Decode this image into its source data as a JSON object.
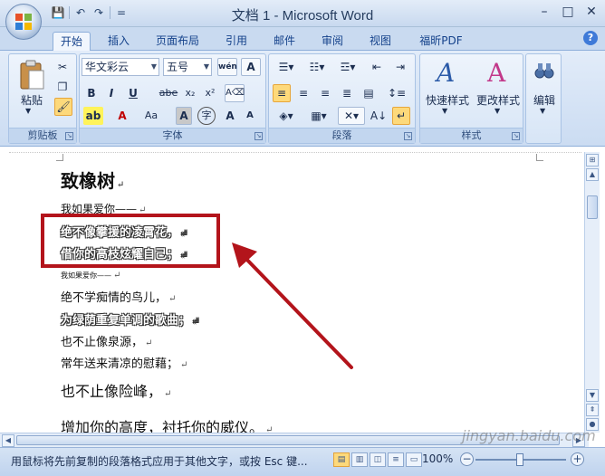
{
  "window": {
    "title": "文档 1 - Microsoft Word",
    "controls": {
      "minimize": "–",
      "maximize": "□",
      "close": "✕"
    }
  },
  "quick_access": {
    "save": "💾",
    "undo": "↶",
    "redo": "↷",
    "customize": "="
  },
  "tabs": [
    {
      "label": "开始",
      "active": true
    },
    {
      "label": "插入"
    },
    {
      "label": "页面布局"
    },
    {
      "label": "引用"
    },
    {
      "label": "邮件"
    },
    {
      "label": "审阅"
    },
    {
      "label": "视图"
    },
    {
      "label": "福昕PDF"
    }
  ],
  "ribbon": {
    "clipboard": {
      "label": "剪贴板",
      "paste": "粘贴"
    },
    "font": {
      "label": "字体",
      "font_name": "华文彩云",
      "font_size": "五号",
      "buttons": [
        "B",
        "I",
        "U",
        "abe",
        "x₂",
        "x²",
        "A",
        "Aa",
        "A",
        "字",
        "A",
        "A"
      ]
    },
    "paragraph": {
      "label": "段落"
    },
    "styles": {
      "label": "样式",
      "quick_styles": "快速样式",
      "change_styles": "更改样式"
    },
    "editing": {
      "label": "编辑",
      "edit": "编辑"
    }
  },
  "document": {
    "lines": [
      {
        "text": "致橡树",
        "style": "heading"
      },
      {
        "text": "我如果爱你——",
        "style": "small"
      },
      {
        "text": "绝不像攀援的凌霄花，",
        "style": "outline"
      },
      {
        "text": "借你的高枝炫耀自己；",
        "style": "outline"
      },
      {
        "text": "我如果爱你——",
        "style": "tiny"
      },
      {
        "text": "绝不学痴情的鸟儿，",
        "style": "normal"
      },
      {
        "text": "为绿荫重复单调的歌曲；",
        "style": "outline"
      },
      {
        "text": "也不止像泉源，",
        "style": "normal"
      },
      {
        "text": "常年送来清凉的慰藉；",
        "style": "normal"
      },
      {
        "text": "也不止像险峰，",
        "style": "large"
      },
      {
        "text": "增加你的高度，衬托你的威仪。",
        "style": "large"
      }
    ]
  },
  "statusbar": {
    "message": "用鼠标将先前复制的段落格式应用于其他文字，或按 Esc 键...",
    "zoom": "100%",
    "zoom_level": 0.5
  },
  "watermark": "jingyan.baidu.com",
  "colors": {
    "highlight_box": "#b3141b",
    "accent": "#15428b"
  }
}
